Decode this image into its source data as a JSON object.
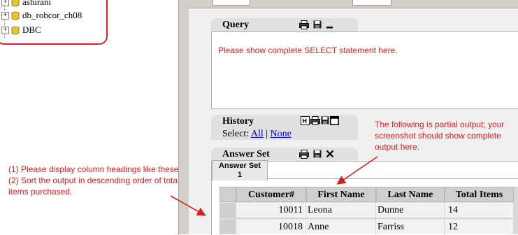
{
  "tree": {
    "items": [
      {
        "label": "ashirani"
      },
      {
        "label": "db_robcor_ch08"
      },
      {
        "label": "DBC"
      }
    ]
  },
  "query": {
    "title": "Query",
    "placeholder_note": "Please show complete SELECT statement here."
  },
  "history": {
    "title": "History",
    "select_label": "Select:",
    "all_link": "All",
    "separator": "|",
    "none_link": "None"
  },
  "answer_set": {
    "title": "Answer Set",
    "tab_label": "Answer Set",
    "tab_number": "1",
    "columns": [
      "Customer#",
      "First Name",
      "Last Name",
      "Total Items"
    ],
    "rows": [
      [
        "10011",
        "Leona",
        "Dunne",
        "14"
      ],
      [
        "10018",
        "Anne",
        "Farriss",
        "12"
      ]
    ]
  },
  "annotations": {
    "left_note": "(1) Please display column headings like these. (2) Sort the output in descending order of total items purchased.",
    "right_note": "The following is partial output; your screenshot should show complete output here."
  },
  "colors": {
    "annotation": "#d42020",
    "link": "#0000cc"
  },
  "icons": [
    "database-icon",
    "printer-icon",
    "save-icon",
    "minimize-icon",
    "maximize-icon",
    "close-icon",
    "history-icon"
  ]
}
